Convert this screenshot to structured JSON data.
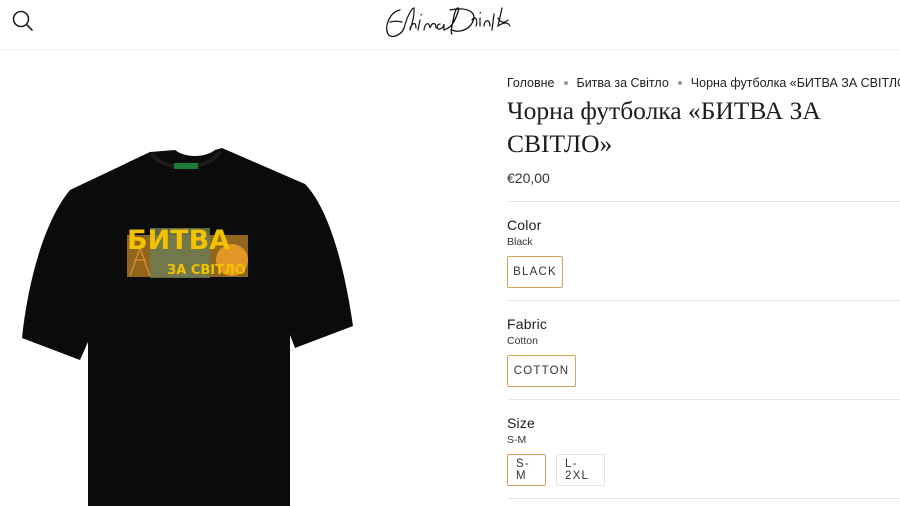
{
  "header": {
    "logo_text": "Ehtinam Dmitrik",
    "search_icon": "search-icon"
  },
  "product_image_alt": "БИТВА ЗА СВІТЛО",
  "breadcrumb": {
    "home": "Головне",
    "collection": "Битва за Світло",
    "current": "Чорна футболка «БИТВА ЗА СВІТЛО»"
  },
  "product": {
    "title": "Чорна футболка «БИТВА ЗА СВІТЛО»",
    "price": "€20,00",
    "shirt_print_line1": "БИТВА",
    "shirt_print_line2": "ЗА СВІТЛО"
  },
  "options": {
    "color": {
      "label": "Color",
      "value": "Black",
      "choices": [
        "BLACK"
      ]
    },
    "fabric": {
      "label": "Fabric",
      "value": "Cotton",
      "choices": [
        "COTTON"
      ]
    },
    "size": {
      "label": "Size",
      "value": "S-M",
      "choices": [
        "S-M",
        "L-2XL"
      ]
    }
  },
  "colors": {
    "accent": "#d7a35c",
    "shirt": "#0b0b0b",
    "print_yellow": "#f2c200"
  }
}
